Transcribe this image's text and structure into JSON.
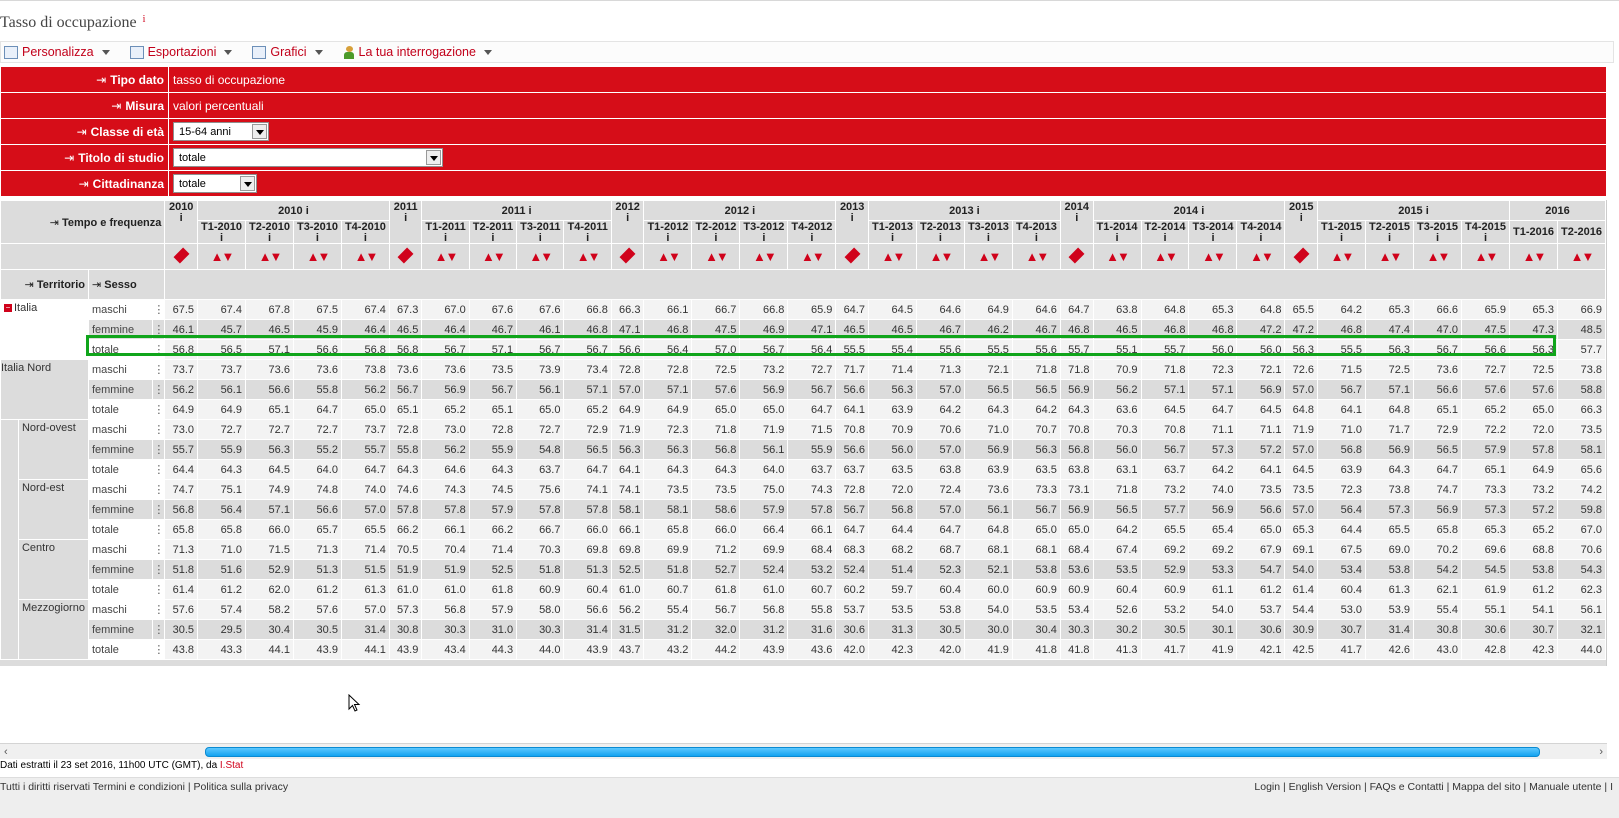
{
  "title": "Tasso di occupazione",
  "title_info": "i",
  "toolbar": [
    {
      "label": "Personalizza",
      "icon": "customize-icon"
    },
    {
      "label": "Esportazioni",
      "icon": "export-icon"
    },
    {
      "label": "Grafici",
      "icon": "chart-icon"
    },
    {
      "label": "La tua interrogazione",
      "icon": "user-icon"
    }
  ],
  "dimensions": [
    {
      "label": "Tipo dato",
      "value": "tasso di occupazione",
      "type": "text"
    },
    {
      "label": "Misura",
      "value": "valori percentuali",
      "type": "text"
    },
    {
      "label": "Classe di età",
      "value": "15-64 anni",
      "type": "select"
    },
    {
      "label": "Titolo di studio",
      "value": "totale",
      "type": "select"
    },
    {
      "label": "Cittadinanza",
      "value": "totale",
      "type": "select"
    }
  ],
  "row_header_label": "Tempo e frequenza",
  "territorio_label": "Territorio",
  "sesso_label": "Sesso",
  "columns": [
    {
      "year": "2010",
      "q": "",
      "annual": true
    },
    {
      "year": "2010",
      "q": "T1-2010"
    },
    {
      "year": "",
      "q": "T2-2010"
    },
    {
      "year": "",
      "q": "T3-2010"
    },
    {
      "year": "",
      "q": "T4-2010"
    },
    {
      "year": "2011",
      "q": "",
      "annual": true
    },
    {
      "year": "2011",
      "q": "T1-2011"
    },
    {
      "year": "",
      "q": "T2-2011"
    },
    {
      "year": "",
      "q": "T3-2011"
    },
    {
      "year": "",
      "q": "T4-2011"
    },
    {
      "year": "2012",
      "q": "",
      "annual": true
    },
    {
      "year": "2012",
      "q": "T1-2012"
    },
    {
      "year": "",
      "q": "T2-2012"
    },
    {
      "year": "",
      "q": "T3-2012"
    },
    {
      "year": "",
      "q": "T4-2012"
    },
    {
      "year": "2013",
      "q": "",
      "annual": true
    },
    {
      "year": "2013",
      "q": "T1-2013"
    },
    {
      "year": "",
      "q": "T2-2013"
    },
    {
      "year": "",
      "q": "T3-2013"
    },
    {
      "year": "",
      "q": "T4-2013"
    },
    {
      "year": "2014",
      "q": "",
      "annual": true
    },
    {
      "year": "2014",
      "q": "T1-2014"
    },
    {
      "year": "",
      "q": "T2-2014"
    },
    {
      "year": "",
      "q": "T3-2014"
    },
    {
      "year": "",
      "q": "T4-2014"
    },
    {
      "year": "2015",
      "q": "",
      "annual": true
    },
    {
      "year": "2015",
      "q": "T1-2015"
    },
    {
      "year": "",
      "q": "T2-2015"
    },
    {
      "year": "",
      "q": "T3-2015"
    },
    {
      "year": "",
      "q": "T4-2015"
    },
    {
      "year": "2016",
      "q": "T1-2016"
    },
    {
      "year": "",
      "q": "T2-2016"
    }
  ],
  "year_groups": [
    {
      "label": "2010",
      "annual": "2010"
    },
    {
      "label": "2011",
      "annual": "2011"
    },
    {
      "label": "2012",
      "annual": "2012"
    },
    {
      "label": "2013",
      "annual": "2013"
    },
    {
      "label": "2014",
      "annual": "2014"
    },
    {
      "label": "2015",
      "annual": "2015"
    },
    {
      "label": "2016",
      "annual": ""
    }
  ],
  "regions": [
    {
      "name": "Italia",
      "collapse": "−",
      "rows": [
        {
          "sex": "maschi",
          "v": [
            67.5,
            67.4,
            67.8,
            67.5,
            67.4,
            67.3,
            67.0,
            67.6,
            67.6,
            66.8,
            66.3,
            66.1,
            66.7,
            66.8,
            65.9,
            64.7,
            64.5,
            64.6,
            64.9,
            64.6,
            64.7,
            63.8,
            64.8,
            65.3,
            64.8,
            65.5,
            64.2,
            65.3,
            66.6,
            65.9,
            65.3,
            66.9
          ]
        },
        {
          "sex": "femmine",
          "v": [
            46.1,
            45.7,
            46.5,
            45.9,
            46.4,
            46.5,
            46.4,
            46.7,
            46.1,
            46.8,
            47.1,
            46.8,
            47.5,
            46.9,
            47.1,
            46.5,
            46.5,
            46.7,
            46.2,
            46.7,
            46.8,
            46.5,
            46.8,
            46.8,
            47.2,
            47.2,
            46.8,
            47.4,
            47.0,
            47.5,
            47.3,
            48.5
          ]
        },
        {
          "sex": "totale",
          "v": [
            56.8,
            56.5,
            57.1,
            56.6,
            56.8,
            56.8,
            56.7,
            57.1,
            56.7,
            56.7,
            56.6,
            56.4,
            57.0,
            56.7,
            56.4,
            55.5,
            55.4,
            55.6,
            55.5,
            55.6,
            55.7,
            55.1,
            55.7,
            56.0,
            56.0,
            56.3,
            55.5,
            56.3,
            56.7,
            56.6,
            56.3,
            57.7
          ]
        }
      ]
    },
    {
      "name": "Italia Nord",
      "rows": [
        {
          "sex": "maschi",
          "v": [
            73.7,
            73.7,
            73.6,
            73.6,
            73.8,
            73.6,
            73.6,
            73.5,
            73.9,
            73.4,
            72.8,
            72.8,
            72.5,
            73.2,
            72.7,
            71.7,
            71.4,
            71.3,
            72.1,
            71.8,
            71.8,
            70.9,
            71.8,
            72.3,
            72.1,
            72.6,
            71.5,
            72.5,
            73.6,
            72.7,
            72.5,
            73.8
          ]
        },
        {
          "sex": "femmine",
          "v": [
            56.2,
            56.1,
            56.6,
            55.8,
            56.2,
            56.7,
            56.9,
            56.7,
            56.1,
            57.1,
            57.0,
            57.1,
            57.6,
            56.9,
            56.7,
            56.6,
            56.3,
            57.0,
            56.5,
            56.5,
            56.9,
            56.2,
            57.1,
            57.1,
            56.9,
            57.0,
            56.7,
            57.1,
            56.6,
            57.6,
            57.6,
            58.8
          ]
        },
        {
          "sex": "totale",
          "v": [
            64.9,
            64.9,
            65.1,
            64.7,
            65.0,
            65.1,
            65.2,
            65.1,
            65.0,
            65.2,
            64.9,
            64.9,
            65.0,
            65.0,
            64.7,
            64.1,
            63.9,
            64.2,
            64.3,
            64.2,
            64.3,
            63.6,
            64.5,
            64.7,
            64.5,
            64.8,
            64.1,
            64.8,
            65.1,
            65.2,
            65.0,
            66.3
          ]
        }
      ]
    },
    {
      "name": "Nord-ovest",
      "rows": [
        {
          "sex": "maschi",
          "v": [
            73.0,
            72.7,
            72.7,
            72.7,
            73.7,
            72.8,
            73.0,
            72.8,
            72.7,
            72.9,
            71.9,
            72.3,
            71.8,
            71.9,
            71.5,
            70.8,
            70.9,
            70.6,
            71.0,
            70.7,
            70.8,
            70.3,
            70.8,
            71.1,
            71.1,
            71.9,
            71.0,
            71.7,
            72.9,
            72.2,
            72.0,
            73.5
          ]
        },
        {
          "sex": "femmine",
          "v": [
            55.7,
            55.9,
            56.3,
            55.2,
            55.7,
            55.8,
            56.2,
            55.9,
            54.8,
            56.5,
            56.3,
            56.3,
            56.8,
            56.1,
            55.9,
            56.6,
            56.0,
            57.0,
            56.9,
            56.3,
            56.8,
            56.0,
            56.7,
            57.3,
            57.2,
            57.0,
            56.8,
            56.9,
            56.5,
            57.9,
            57.8,
            58.1
          ]
        },
        {
          "sex": "totale",
          "v": [
            64.4,
            64.3,
            64.5,
            64.0,
            64.7,
            64.3,
            64.6,
            64.3,
            63.7,
            64.7,
            64.1,
            64.3,
            64.3,
            64.0,
            63.7,
            63.7,
            63.5,
            63.8,
            63.9,
            63.5,
            63.8,
            63.1,
            63.7,
            64.2,
            64.1,
            64.5,
            63.9,
            64.3,
            64.7,
            65.1,
            64.9,
            65.6
          ]
        }
      ]
    },
    {
      "name": "Nord-est",
      "rows": [
        {
          "sex": "maschi",
          "v": [
            74.7,
            75.1,
            74.9,
            74.8,
            74.0,
            74.6,
            74.3,
            74.5,
            75.6,
            74.1,
            74.1,
            73.5,
            73.5,
            75.0,
            74.3,
            72.8,
            72.0,
            72.4,
            73.6,
            73.3,
            73.1,
            71.8,
            73.2,
            74.0,
            73.5,
            73.5,
            72.3,
            73.8,
            74.7,
            73.3,
            73.2,
            74.2
          ]
        },
        {
          "sex": "femmine",
          "v": [
            56.8,
            56.4,
            57.1,
            56.6,
            57.0,
            57.8,
            57.8,
            57.9,
            57.8,
            57.8,
            58.1,
            58.1,
            58.6,
            57.9,
            57.8,
            56.7,
            56.8,
            57.0,
            56.1,
            56.7,
            56.9,
            56.5,
            57.7,
            56.9,
            56.6,
            57.0,
            56.4,
            57.3,
            56.9,
            57.3,
            57.2,
            59.8
          ]
        },
        {
          "sex": "totale",
          "v": [
            65.8,
            65.8,
            66.0,
            65.7,
            65.5,
            66.2,
            66.1,
            66.2,
            66.7,
            66.0,
            66.1,
            65.8,
            66.0,
            66.4,
            66.1,
            64.7,
            64.4,
            64.7,
            64.8,
            65.0,
            65.0,
            64.2,
            65.5,
            65.4,
            65.0,
            65.3,
            64.4,
            65.5,
            65.8,
            65.3,
            65.2,
            67.0
          ]
        }
      ]
    },
    {
      "name": "Centro",
      "rows": [
        {
          "sex": "maschi",
          "v": [
            71.3,
            71.0,
            71.5,
            71.3,
            71.4,
            70.5,
            70.4,
            71.4,
            70.3,
            69.8,
            69.8,
            69.9,
            71.2,
            69.9,
            68.4,
            68.3,
            68.2,
            68.7,
            68.1,
            68.1,
            68.4,
            67.4,
            69.2,
            69.2,
            67.9,
            69.1,
            67.5,
            69.0,
            70.2,
            69.6,
            68.8,
            70.6
          ]
        },
        {
          "sex": "femmine",
          "v": [
            51.8,
            51.6,
            52.9,
            51.3,
            51.5,
            51.9,
            51.9,
            52.5,
            51.8,
            51.3,
            52.5,
            51.8,
            52.7,
            52.4,
            53.2,
            52.4,
            51.4,
            52.3,
            52.1,
            53.8,
            53.6,
            53.5,
            52.9,
            53.3,
            54.7,
            54.0,
            53.4,
            53.8,
            54.2,
            54.5,
            53.8,
            54.3
          ]
        },
        {
          "sex": "totale",
          "v": [
            61.4,
            61.2,
            62.0,
            61.2,
            61.3,
            61.0,
            61.0,
            61.8,
            60.9,
            60.4,
            61.0,
            60.7,
            61.8,
            61.0,
            60.7,
            60.2,
            59.7,
            60.4,
            60.0,
            60.9,
            60.9,
            60.4,
            60.9,
            61.1,
            61.2,
            61.4,
            60.4,
            61.3,
            62.1,
            61.9,
            61.2,
            62.3
          ]
        }
      ]
    },
    {
      "name": "Mezzogiorno",
      "rows": [
        {
          "sex": "maschi",
          "v": [
            57.6,
            57.4,
            58.2,
            57.6,
            57.0,
            57.3,
            56.8,
            57.9,
            58.0,
            56.6,
            56.2,
            55.4,
            56.7,
            56.8,
            55.8,
            53.7,
            53.5,
            53.8,
            54.0,
            53.5,
            53.4,
            52.6,
            53.2,
            54.0,
            53.7,
            54.4,
            53.0,
            53.9,
            55.4,
            55.1,
            54.1,
            56.1
          ]
        },
        {
          "sex": "femmine",
          "v": [
            30.5,
            29.5,
            30.4,
            30.5,
            31.4,
            30.8,
            30.3,
            31.0,
            30.3,
            31.4,
            31.5,
            31.2,
            32.0,
            31.2,
            31.6,
            30.6,
            31.3,
            30.5,
            30.0,
            30.4,
            30.3,
            30.2,
            30.5,
            30.1,
            30.6,
            30.9,
            30.7,
            31.4,
            30.8,
            30.6,
            30.7,
            32.1
          ]
        },
        {
          "sex": "totale",
          "v": [
            43.8,
            43.3,
            44.1,
            43.9,
            44.1,
            43.9,
            43.4,
            44.3,
            44.0,
            43.9,
            43.7,
            43.2,
            44.2,
            43.9,
            43.6,
            42.0,
            42.3,
            42.0,
            41.9,
            41.8,
            41.8,
            41.3,
            41.7,
            41.9,
            42.1,
            42.5,
            41.7,
            42.6,
            43.0,
            42.8,
            42.3,
            44.0
          ]
        }
      ]
    }
  ],
  "footnote_text": "Dati estratti il 23 set 2016, 11h00 UTC (GMT), da ",
  "footnote_link": "I.Stat",
  "footer_left": "Tutti i diritti riservati Termini e condizioni  |  Politica sulla privacy",
  "footer_right": "Login | English Version | FAQs e Contatti | Mappa del sito | Manuale utente | I",
  "highlight_color": "#10a51b",
  "accent_color": "#d60d18"
}
